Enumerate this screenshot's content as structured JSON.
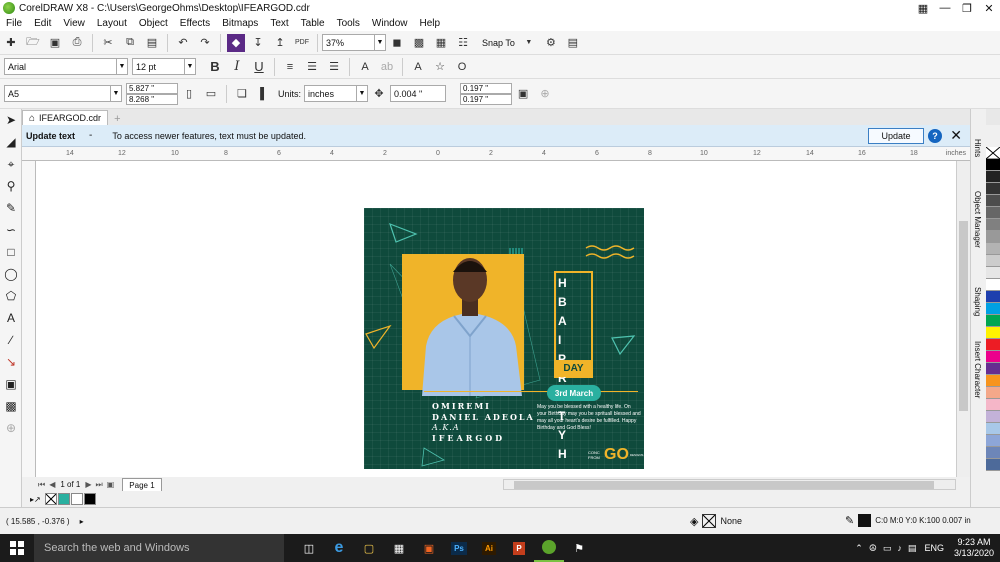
{
  "window": {
    "title": "CorelDRAW X8 - C:\\Users\\GeorgeOhms\\Desktop\\IFEARGOD.cdr"
  },
  "menu": [
    "File",
    "Edit",
    "View",
    "Layout",
    "Object",
    "Effects",
    "Bitmaps",
    "Text",
    "Table",
    "Tools",
    "Window",
    "Help"
  ],
  "toolbar": {
    "zoom": "37%",
    "snap_to": "Snap To",
    "pdf": "PDF"
  },
  "propbar": {
    "font": "Arial",
    "font_size": "12 pt"
  },
  "paper": {
    "size": "A5",
    "width": "5.827 \"",
    "height": "8.268 \"",
    "units_label": "Units:",
    "units": "inches",
    "nudge": "0.004 \"",
    "dup_x": "0.197 \"",
    "dup_y": "0.197 \""
  },
  "doc_tab": "IFEARGOD.cdr",
  "notification": {
    "title": "Update text",
    "dash": "-",
    "message": "To access newer features, text must be updated.",
    "button": "Update"
  },
  "ruler": {
    "ticks": [
      "14",
      "12",
      "10",
      "8",
      "6",
      "4",
      "2",
      "0",
      "2",
      "4",
      "6",
      "8",
      "10",
      "12",
      "14",
      "16",
      "18"
    ],
    "units": "inches"
  },
  "design": {
    "hb_text": "H B A I P R P T Y H",
    "day": "DAY",
    "date": "3rd March",
    "name1": "OMIREMI",
    "name2": "DANIEL ADEOLA",
    "aka": "A.K.A",
    "alias": "IFEARGOD",
    "wish": "May you be blessed with a healthy life. On your Birthday may you be sprituall blessed and may all your heart's desire be fulfilled. Happy Birthday and God Bless!",
    "logo_small": "CONC FROM",
    "logo_big": "GO",
    "logo_sub": "DESIGNS"
  },
  "pages": {
    "count": "1 of 1",
    "tab": "Page 1"
  },
  "dockers": [
    "Hints",
    "Object Manager",
    "Shaping",
    "Insert Character"
  ],
  "status": {
    "coords": "( 15.585 , -0.376 )",
    "fill": "None",
    "cmyk": "C:0 M:0 Y:0 K:100  0.007 in"
  },
  "taskbar": {
    "search": "Search the web and Windows",
    "time": "9:23 AM",
    "date": "3/13/2020",
    "lang": "ENG"
  },
  "colors": {
    "design_bg": "#0f4a3c",
    "accent_yellow": "#f0b429",
    "accent_teal": "#2ab0a0"
  }
}
